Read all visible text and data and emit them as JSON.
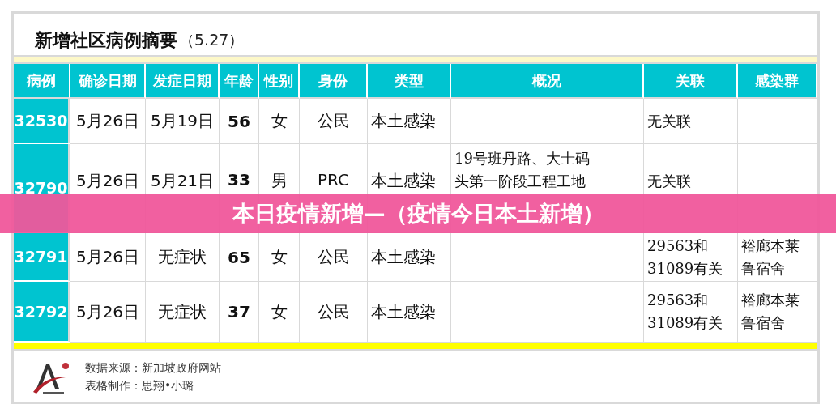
{
  "title": "新增社区病例摘要",
  "title_date": "（5.27）",
  "columns": [
    "病例",
    "确诊日期",
    "发症日期",
    "年龄",
    "性别",
    "身份",
    "类型",
    "概况",
    "关联",
    "感染群"
  ],
  "rows": [
    {
      "case": "32530",
      "confirmed": "5月26日",
      "onset": "5月19日",
      "age": "56",
      "sex": "女",
      "status": "公民",
      "type": "本土感染",
      "link": [
        "无关联"
      ]
    },
    {
      "case": "32790",
      "confirmed": "5月26日",
      "onset": "5月21日",
      "age": "33",
      "sex": "男",
      "status": "PRC",
      "type": "本土感染",
      "summary": [
        "19号班丹路、大士码",
        "头第一阶段工程工地"
      ],
      "link": [
        "无关联"
      ]
    },
    {
      "case": "32791",
      "confirmed": "5月26日",
      "onset": "无症状",
      "age": "65",
      "sex": "女",
      "status": "公民",
      "type": "本土感染",
      "link": [
        "29563和",
        "31089有关"
      ],
      "cluster": [
        "裕廊本莱",
        "鲁宿舍"
      ]
    },
    {
      "case": "32792",
      "confirmed": "5月26日",
      "onset": "无症状",
      "age": "37",
      "sex": "女",
      "status": "公民",
      "type": "本土感染",
      "link": [
        "29563和",
        "31089有关"
      ],
      "cluster": [
        "裕廊本莱",
        "鲁宿舍"
      ]
    }
  ],
  "banner": "本日疫情新增—（疫情今日本土新增）",
  "footer": {
    "source": "数据来源：新加坡政府网站",
    "maker": "表格制作：思翔•小璐"
  }
}
